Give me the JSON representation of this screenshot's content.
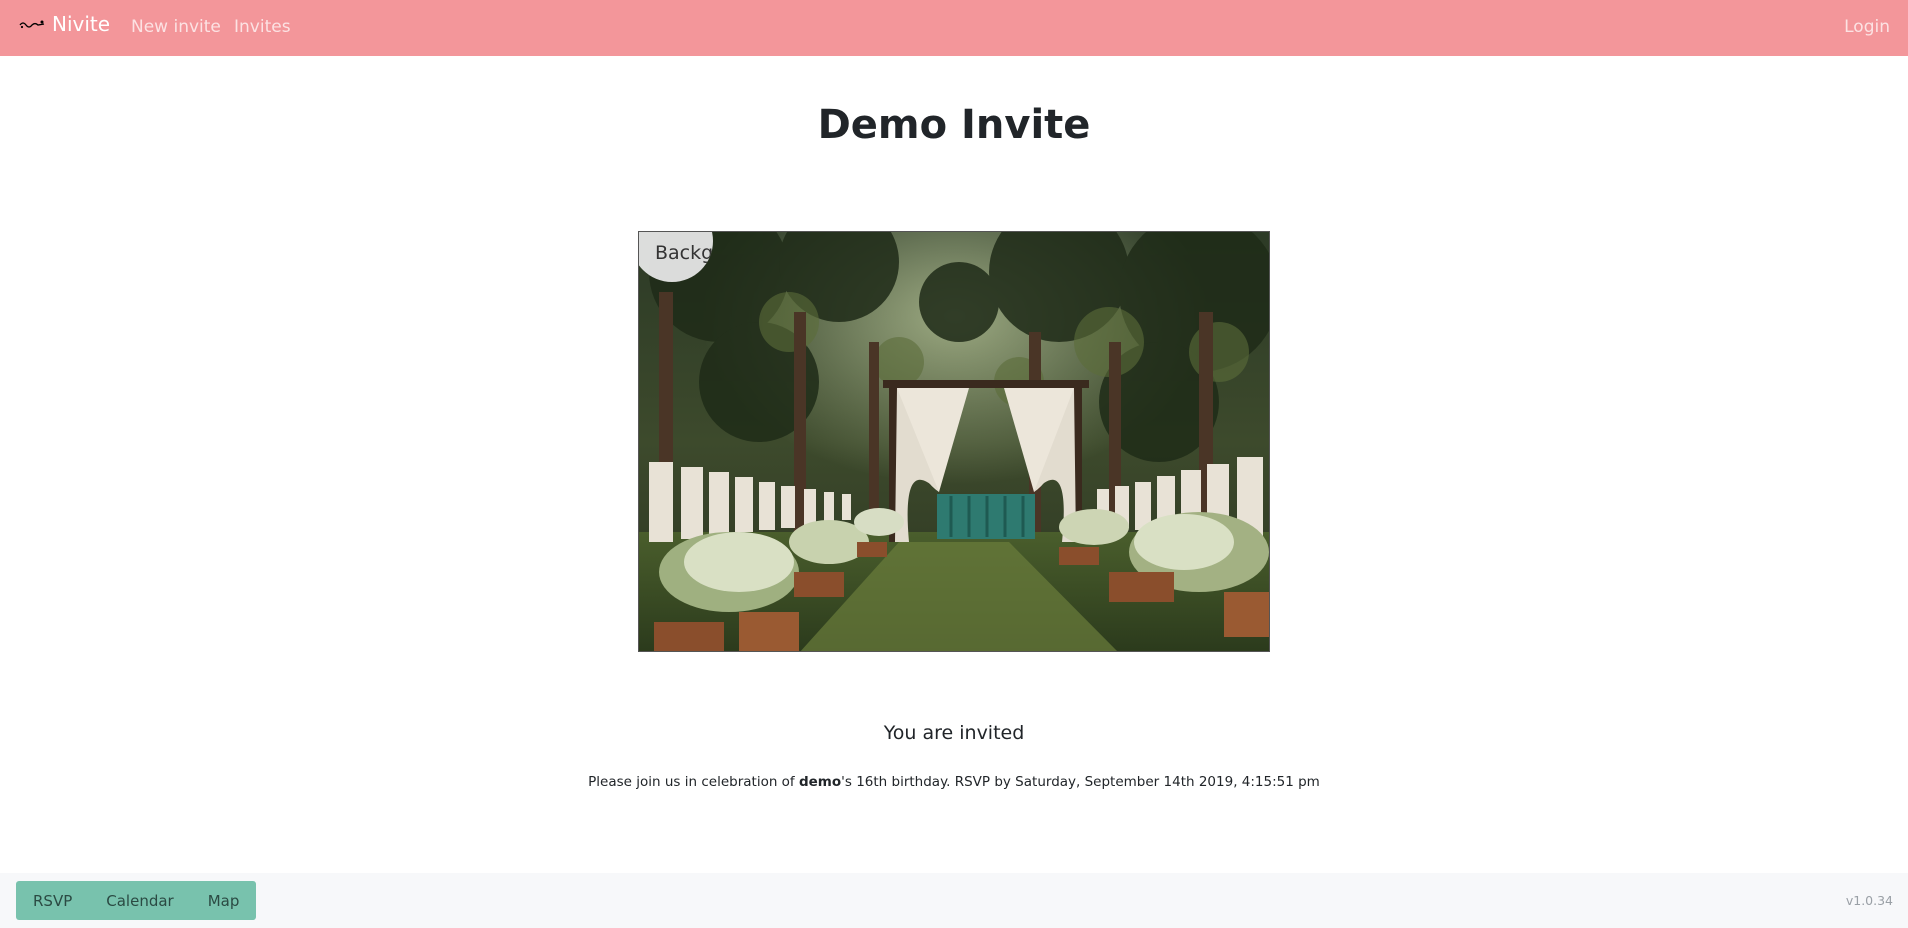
{
  "navbar": {
    "brand": "Nivite",
    "links": [
      "New invite",
      "Invites"
    ],
    "login": "Login",
    "color": "#f3969a"
  },
  "invite": {
    "title": "Demo Invite",
    "image_badge": "Background",
    "subtitle": "You are invited",
    "message_prefix": "Please join us in celebration of ",
    "message_name": "demo",
    "message_suffix": "'s 16th birthday. RSVP by Saturday, September 14th 2019, 4:15:51 pm"
  },
  "footer": {
    "buttons": [
      "RSVP",
      "Calendar",
      "Map"
    ],
    "version": "v1.0.34",
    "button_color": "#78c2ad"
  }
}
